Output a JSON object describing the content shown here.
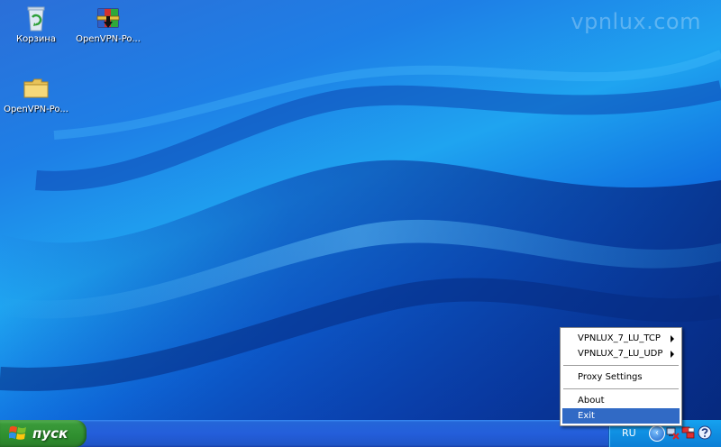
{
  "watermark": "vpnlux.com",
  "desktop": {
    "icons": [
      {
        "label": "Корзина",
        "icon": "recycle-bin-icon"
      },
      {
        "label": "OpenVPN-Po...",
        "icon": "archive-icon"
      },
      {
        "label": "OpenVPN-Po...",
        "icon": "folder-icon"
      }
    ]
  },
  "taskbar": {
    "start_label": "пуск",
    "language": "RU",
    "tray_icons": [
      "show-hidden-icons",
      "network-disconnected-icon",
      "openvpn-icon",
      "help-icon"
    ]
  },
  "context_menu": {
    "items": [
      {
        "label": "VPNLUX_7_LU_TCP",
        "submenu": true
      },
      {
        "label": "VPNLUX_7_LU_UDP",
        "submenu": true
      },
      {
        "label": "Proxy Settings",
        "submenu": false
      },
      {
        "label": "About",
        "submenu": false
      },
      {
        "label": "Exit",
        "submenu": false,
        "selected": true
      }
    ]
  },
  "colors": {
    "menu_highlight": "#316ac5",
    "taskbar_blue": "#245edb",
    "start_green": "#3a9a3a",
    "tray_blue": "#0f8fe2"
  }
}
